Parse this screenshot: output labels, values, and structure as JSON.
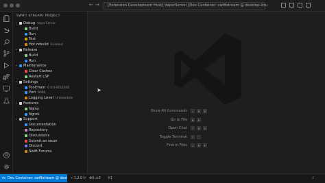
{
  "titlebar": {
    "search_text": "[Extension Development Host] VaporServer [Dev Container: swiftstream @ desktop-linu"
  },
  "sidebar": {
    "title": "SWIFT STREAM: PROJECT",
    "tree": [
      {
        "level": 0,
        "chevron": "⌄",
        "icon": "debug",
        "label": "Debug",
        "desc": "VaporServer"
      },
      {
        "level": 1,
        "icon": "hammer",
        "label": "Build",
        "desc": ""
      },
      {
        "level": 1,
        "icon": "play",
        "label": "Run",
        "desc": ""
      },
      {
        "level": 1,
        "icon": "beaker",
        "label": "Test",
        "desc": ""
      },
      {
        "level": 1,
        "icon": "fire",
        "label": "Hot rebuild",
        "desc": "Enabled"
      },
      {
        "level": 0,
        "chevron": "⌄",
        "icon": "eye",
        "label": "Release",
        "desc": ""
      },
      {
        "level": 1,
        "icon": "hammer",
        "label": "Build",
        "desc": ""
      },
      {
        "level": 1,
        "icon": "play",
        "label": "Run",
        "desc": ""
      },
      {
        "level": 0,
        "chevron": "⌄",
        "icon": "tools",
        "label": "Maintenance",
        "desc": ""
      },
      {
        "level": 1,
        "icon": "trash",
        "label": "Clear Caches",
        "desc": ""
      },
      {
        "level": 1,
        "icon": "restart",
        "label": "Restart LSP",
        "desc": ""
      },
      {
        "level": 0,
        "chevron": "⌄",
        "icon": "gear",
        "label": "Settings",
        "desc": ""
      },
      {
        "level": 1,
        "icon": "toolchain",
        "label": "Toolchain",
        "desc": "6.0.0-RELEASE"
      },
      {
        "level": 1,
        "icon": "port",
        "label": "Port",
        "desc": "8080"
      },
      {
        "level": 1,
        "icon": "log",
        "label": "Logging Level",
        "desc": "Unbearable"
      },
      {
        "level": 0,
        "chevron": "⌄",
        "icon": "features",
        "label": "Features",
        "desc": ""
      },
      {
        "level": 1,
        "icon": "nginx",
        "label": "Nginx",
        "desc": ""
      },
      {
        "level": 1,
        "icon": "ngrok",
        "label": "Ngrok",
        "desc": ""
      },
      {
        "level": 0,
        "chevron": "⌄",
        "icon": "heart",
        "label": "Support",
        "desc": ""
      },
      {
        "level": 1,
        "icon": "book",
        "label": "Documentation",
        "desc": ""
      },
      {
        "level": 1,
        "icon": "repo",
        "label": "Repository",
        "desc": ""
      },
      {
        "level": 1,
        "icon": "discussion",
        "label": "Discussions",
        "desc": ""
      },
      {
        "level": 1,
        "icon": "issue",
        "label": "Submit an issue",
        "desc": ""
      },
      {
        "level": 1,
        "icon": "discord",
        "label": "Discord",
        "desc": ""
      },
      {
        "level": 1,
        "icon": "forum",
        "label": "Swift Forums",
        "desc": ""
      }
    ]
  },
  "editor": {
    "hints": [
      {
        "label": "Show All Commands",
        "keys": [
          "⇧",
          "⌘",
          "P"
        ]
      },
      {
        "label": "Go to File",
        "keys": [
          "⌘",
          "P"
        ]
      },
      {
        "label": "Open Chat",
        "keys": [
          "^",
          "⌘",
          "I"
        ]
      },
      {
        "label": "Toggle Terminal",
        "keys": [
          "^",
          "`"
        ]
      },
      {
        "label": "Find in Files",
        "keys": [
          "⇧",
          "⌘",
          "F"
        ]
      }
    ]
  },
  "statusbar": {
    "remote": "Dev Container: swiftstream @ desktop-lin...",
    "branch": "1.2.0",
    "errors": "0",
    "warnings": "0",
    "ports": "1"
  },
  "colors": {
    "accent": "#0078d4",
    "icon_blue": "#3794ff",
    "icon_red": "#f14c4c",
    "icon_orange": "#d18616",
    "icon_green": "#89d185"
  }
}
